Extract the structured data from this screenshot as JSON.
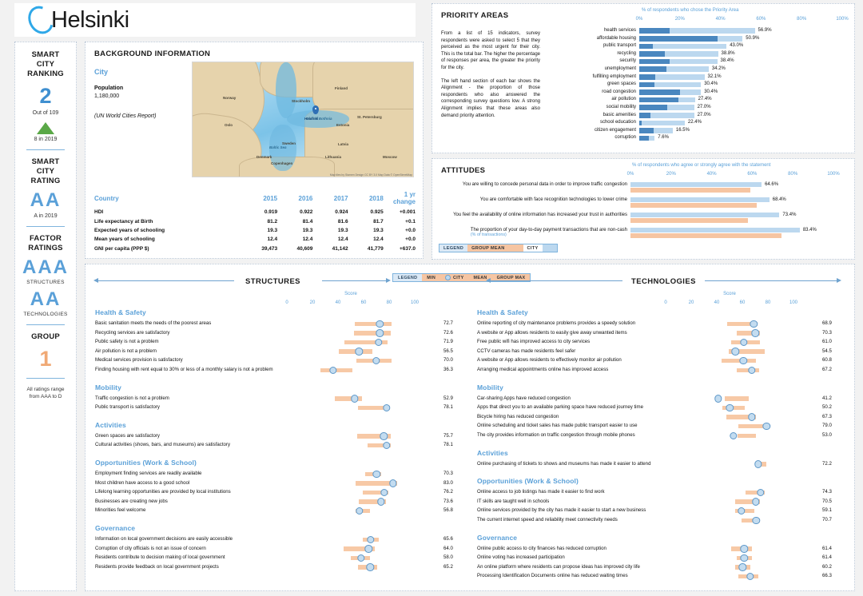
{
  "header": {
    "city_name": "Helsinki",
    "logo_icon": "arc-c-logo-icon"
  },
  "ratings": {
    "ranking_title": "SMART\nCITY\nRANKING",
    "ranking_title_l1": "SMART",
    "ranking_title_l2": "CITY",
    "ranking_title_l3": "RANKING",
    "ranking_value": "2",
    "ranking_outof": "Out of 109",
    "trend_icon": "triangle-up-icon",
    "ranking_prev": "8 in 2019",
    "rating_title_l1": "SMART",
    "rating_title_l2": "CITY",
    "rating_title_l3": "RATING",
    "rating_value": "AA",
    "rating_prev": "A in 2019",
    "factor_title_l1": "FACTOR",
    "factor_title_l2": "RATINGS",
    "structures_grade": "AAA",
    "structures_label": "STRUCTURES",
    "technologies_grade": "AA",
    "technologies_label": "TECHNOLOGIES",
    "group_title": "GROUP",
    "group_value": "1",
    "footnote_l1": "All ratings range",
    "footnote_l2": "from AAA to D"
  },
  "background": {
    "title": "BACKGROUND INFORMATION",
    "city_label": "City",
    "population_label": "Population",
    "population_value": "1,180,000",
    "source": "(UN World Cities Report)",
    "map": {
      "credit": "Map tiles by Stamen Design CC BY 3.0 Map Data © OpenStreetMap",
      "pin_label": "Helsinki",
      "labels": [
        "Norway",
        "Sweden",
        "Finland",
        "Estonia",
        "Latvia",
        "Lithuania",
        "Denmark",
        "Stockholm",
        "Copenhagen",
        "St. Petersburg",
        "Moscow",
        "Gulf of Bothnia",
        "Baltic Sea",
        "Oslo"
      ]
    },
    "table": {
      "columns": [
        "Country",
        "2015",
        "2016",
        "2017",
        "2018",
        "1 yr change"
      ],
      "rows": [
        {
          "name": "HDI",
          "v2015": "0.919",
          "v2016": "0.922",
          "v2017": "0.924",
          "v2018": "0.925",
          "change": "+0.001"
        },
        {
          "name": "Life expectancy at Birth",
          "v2015": "81.2",
          "v2016": "81.4",
          "v2017": "81.6",
          "v2018": "81.7",
          "change": "+0.1"
        },
        {
          "name": "Expected years of schooling",
          "v2015": "19.3",
          "v2016": "19.3",
          "v2017": "19.3",
          "v2018": "19.3",
          "change": "+0.0"
        },
        {
          "name": "Mean years of schooling",
          "v2015": "12.4",
          "v2016": "12.4",
          "v2017": "12.4",
          "v2018": "12.4",
          "change": "+0.0"
        },
        {
          "name": "GNI per capita (PPP $)",
          "v2015": "39,473",
          "v2016": "40,609",
          "v2017": "41,142",
          "v2018": "41,779",
          "change": "+637.0"
        }
      ]
    }
  },
  "priority": {
    "title": "PRIORITY AREAS",
    "description_p1": "From a list of 15 indicators, survey respondents were asked to select 5 that they perceived as the most urgent for their city. This is the total bar. The higher the percentage of responses per area, the greater the priority for the city.",
    "description_p2": "The left hand section of each bar shows the Alignment - the proportion of those respondents who also answered the corresponding survey questions low. A strong Alignment implies that these areas also demand priority attention.",
    "axis_caption": "% of respondents who chose the Priority Area",
    "axis_ticks": [
      "0%",
      "20%",
      "40%",
      "60%",
      "80%",
      "100%"
    ]
  },
  "attitudes": {
    "title": "ATTITUDES",
    "axis_caption": "% of respondents who agree or strongly agree with the statement",
    "axis_ticks": [
      "0%",
      "20%",
      "40%",
      "60%",
      "80%",
      "100%"
    ],
    "legend": {
      "title": "LEGEND",
      "mean_label": "GROUP MEAN",
      "city_label": "CITY"
    }
  },
  "scores": {
    "legend": {
      "title": "LEGEND",
      "min_label": "MIN",
      "city_label": "CITY",
      "mean_label": "MEAN",
      "max_label": "GROUP MAX"
    },
    "structures_title": "STRUCTURES",
    "technologies_title": "TECHNOLOGIES",
    "score_caption": "Score",
    "axis_ticks": [
      "0",
      "20",
      "40",
      "60",
      "80",
      "100"
    ]
  },
  "chart_data": [
    {
      "type": "bar",
      "name": "priority_areas",
      "title": "PRIORITY AREAS",
      "xlabel": "% of respondents who chose the Priority Area",
      "xlim": [
        0,
        100
      ],
      "grid": false,
      "legend": "none",
      "categories": [
        "health services",
        "affordable housing",
        "public transport",
        "recycling",
        "security",
        "unemployment",
        "fulfilling employment",
        "green spaces",
        "road congestion",
        "air pollution",
        "social mobility",
        "basic amenities",
        "school education",
        "citizen engagement",
        "corruption"
      ],
      "values": [
        56.9,
        50.9,
        43.0,
        38.8,
        38.4,
        34.2,
        32.1,
        30.4,
        30.4,
        27.4,
        27.0,
        27.0,
        22.4,
        16.5,
        7.6
      ],
      "value_labels": [
        "56.9%",
        "50.9%",
        "43.0%",
        "38.8%",
        "38.4%",
        "34.2%",
        "32.1%",
        "30.4%",
        "30.4%",
        "27.4%",
        "27.0%",
        "27.0%",
        "22.4%",
        "16.5%",
        "7.6%"
      ],
      "alignment": [
        15.0,
        38.5,
        6.6,
        12.6,
        14.8,
        13.4,
        8.0,
        7.6,
        20.2,
        19.2,
        13.6,
        5.4,
        1.0,
        7.2,
        4.6
      ],
      "series_colors": {
        "total": "#bcd8ef",
        "alignment": "#4a87bf"
      }
    },
    {
      "type": "bar",
      "name": "attitudes",
      "title": "ATTITUDES",
      "xlabel": "% of respondents who agree or strongly agree with the statement",
      "xlim": [
        0,
        100
      ],
      "grid": false,
      "legend": "bottom-left",
      "categories": [
        "You are willing to concede personal data in order to improve traffic congestion",
        "You are comfortable with face recognition technologies to lower crime",
        "You feel the availability of online information has increased your trust in authorities",
        "The proportion of your day-to-day payment transactions that are non-cash"
      ],
      "category_sublabels": [
        "",
        "",
        "",
        "(% of transactions)"
      ],
      "series": [
        {
          "name": "CITY",
          "color": "#bcd8ef",
          "values": [
            64.6,
            68.4,
            73.4,
            83.4
          ]
        },
        {
          "name": "GROUP MEAN",
          "color": "#f6c5a2",
          "values": [
            59.2,
            62.4,
            58.0,
            74.5
          ]
        }
      ],
      "value_labels": [
        "64.6%",
        "68.4%",
        "73.4%",
        "83.4%"
      ]
    },
    {
      "type": "bar",
      "name": "structures_scores",
      "title": "STRUCTURES",
      "xlabel": "Score",
      "xlim": [
        0,
        100
      ],
      "legend": "top",
      "groups": [
        {
          "name": "Health & Safety",
          "rows": [
            {
              "label": "Basic sanitation meets the needs of the poorest areas",
              "value": 72.7,
              "value_label": "72.7",
              "min": 53.0,
              "max": 82.0
            },
            {
              "label": "Recycling services are satisfactory",
              "value": 72.6,
              "value_label": "72.6",
              "min": 52.5,
              "max": 81.5
            },
            {
              "label": "Public safety is not a problem",
              "value": 71.9,
              "value_label": "71.9",
              "min": 45.0,
              "max": 78.5
            },
            {
              "label": "Air pollution is not a problem",
              "value": 56.5,
              "value_label": "56.5",
              "min": 40.5,
              "max": 67.0
            },
            {
              "label": "Medical services provision is satisfactory",
              "value": 70.0,
              "value_label": "70.0",
              "min": 54.5,
              "max": 82.0
            },
            {
              "label": "Finding housing with rent equal to 30% or less of a monthly salary is not a problem",
              "value": 36.3,
              "value_label": "36.3",
              "min": 26.0,
              "max": 51.0
            }
          ]
        },
        {
          "name": "Mobility",
          "rows": [
            {
              "label": "Traffic congestion is not a problem",
              "value": 52.9,
              "value_label": "52.9",
              "min": 37.5,
              "max": 59.0
            },
            {
              "label": "Public transport is satisfactory",
              "value": 78.1,
              "value_label": "78.1",
              "min": 55.5,
              "max": 80.5
            }
          ]
        },
        {
          "name": "Activities",
          "rows": [
            {
              "label": "Green spaces are satisfactory",
              "value": 75.7,
              "value_label": "75.7",
              "min": 55.0,
              "max": 81.5
            },
            {
              "label": "Cultural activities (shows, bars, and museums) are satisfactory",
              "value": 78.1,
              "value_label": "78.1",
              "min": 63.0,
              "max": 81.5
            }
          ]
        },
        {
          "name": "Opportunities (Work & School)",
          "rows": [
            {
              "label": "Employment finding services are readily available",
              "value": 70.3,
              "value_label": "70.3",
              "min": 61.0,
              "max": 74.0
            },
            {
              "label": "Most children have access to a good school",
              "value": 83.0,
              "value_label": "83.0",
              "min": 54.0,
              "max": 86.5
            },
            {
              "label": "Lifelong learning opportunities are provided by local institutions",
              "value": 76.2,
              "value_label": "76.2",
              "min": 59.5,
              "max": 79.5
            },
            {
              "label": "Businesses are creating new jobs",
              "value": 73.6,
              "value_label": "73.6",
              "min": 56.5,
              "max": 77.5
            },
            {
              "label": "Minorities feel welcome",
              "value": 56.8,
              "value_label": "56.8",
              "min": 54.0,
              "max": 65.0
            }
          ]
        },
        {
          "name": "Governance",
          "rows": [
            {
              "label": "Information on local government decisions are easily accessible",
              "value": 65.6,
              "value_label": "65.6",
              "min": 59.5,
              "max": 72.0
            },
            {
              "label": "Corruption of city officials is not an issue of concern",
              "value": 64.0,
              "value_label": "64.0",
              "min": 44.5,
              "max": 69.0
            },
            {
              "label": "Residents contribute to decision making of local government",
              "value": 58.0,
              "value_label": "58.0",
              "min": 50.0,
              "max": 65.0
            },
            {
              "label": "Residents provide feedback on local government projects",
              "value": 65.2,
              "value_label": "65.2",
              "min": 55.5,
              "max": 70.5
            }
          ]
        }
      ]
    },
    {
      "type": "bar",
      "name": "technologies_scores",
      "title": "TECHNOLOGIES",
      "xlabel": "Score",
      "xlim": [
        0,
        100
      ],
      "legend": "top",
      "groups": [
        {
          "name": "Health & Safety",
          "rows": [
            {
              "label": "Online reporting of city maintenance problems provides a speedy solution",
              "value": 68.9,
              "value_label": "68.9",
              "min": 48.0,
              "max": 72.0
            },
            {
              "label": "A website or App allows residents to easily give away unwanted items",
              "value": 70.3,
              "value_label": "70.3",
              "min": 55.5,
              "max": 74.0
            },
            {
              "label": "Free public wifi has improved access to city services",
              "value": 61.0,
              "value_label": "61.0",
              "min": 51.5,
              "max": 73.5
            },
            {
              "label": "CCTV cameras has made residents feel safer",
              "value": 54.5,
              "value_label": "54.5",
              "min": 49.5,
              "max": 77.5
            },
            {
              "label": "A website or App allows residents to effectively monitor air pollution",
              "value": 60.8,
              "value_label": "60.8",
              "min": 43.5,
              "max": 70.5
            },
            {
              "label": "Arranging medical appointments online has improved access",
              "value": 67.2,
              "value_label": "67.2",
              "min": 55.5,
              "max": 73.0
            }
          ]
        },
        {
          "name": "Mobility",
          "rows": [
            {
              "label": "Car-sharing Apps have reduced congestion",
              "value": 41.2,
              "value_label": "41.2",
              "min": 46.5,
              "max": 65.0
            },
            {
              "label": "Apps that direct you to an available parking space have reduced journey time",
              "value": 50.2,
              "value_label": "50.2",
              "min": 44.5,
              "max": 62.0
            },
            {
              "label": "Bicycle hiring has reduced congestion",
              "value": 67.3,
              "value_label": "67.3",
              "min": 47.5,
              "max": 70.5
            },
            {
              "label": "Online scheduling and ticket sales has made public transport easier to use",
              "value": 79.0,
              "value_label": "79.0",
              "min": 57.0,
              "max": 79.5
            },
            {
              "label": "The city provides information on traffic congestion through mobile phones",
              "value": 53.0,
              "value_label": "53.0",
              "min": 56.5,
              "max": 70.5
            }
          ]
        },
        {
          "name": "Activities",
          "rows": [
            {
              "label": "Online purchasing of tickets to shows and museums has made it easier to attend",
              "value": 72.2,
              "value_label": "72.2",
              "min": 71.5,
              "max": 79.0
            }
          ]
        },
        {
          "name": "Opportunities (Work & School)",
          "rows": [
            {
              "label": "Online access to job listings has made it easier to find work",
              "value": 74.3,
              "value_label": "74.3",
              "min": 62.5,
              "max": 77.5
            },
            {
              "label": "IT skills are taught well in schools",
              "value": 70.5,
              "value_label": "70.5",
              "min": 54.5,
              "max": 73.5
            },
            {
              "label": "Online services provided by the city has made it easier to start a new business",
              "value": 59.1,
              "value_label": "59.1",
              "min": 54.5,
              "max": 69.5
            },
            {
              "label": "The current internet speed and reliability meet connectivity needs",
              "value": 70.7,
              "value_label": "70.7",
              "min": 59.5,
              "max": 73.5
            }
          ]
        },
        {
          "name": "Governance",
          "rows": [
            {
              "label": "Online public access to city finances has reduced corruption",
              "value": 61.4,
              "value_label": "61.4",
              "min": 51.5,
              "max": 67.5
            },
            {
              "label": "Online voting has increased participation",
              "value": 61.4,
              "value_label": "61.4",
              "min": 55.5,
              "max": 67.5
            },
            {
              "label": "An online platform where residents can propose ideas has improved city life",
              "value": 60.2,
              "value_label": "60.2",
              "min": 54.5,
              "max": 66.0
            },
            {
              "label": "Processing Identification Documents online has reduced waiting times",
              "value": 66.3,
              "value_label": "66.3",
              "min": 57.0,
              "max": 72.5
            }
          ]
        }
      ]
    }
  ]
}
